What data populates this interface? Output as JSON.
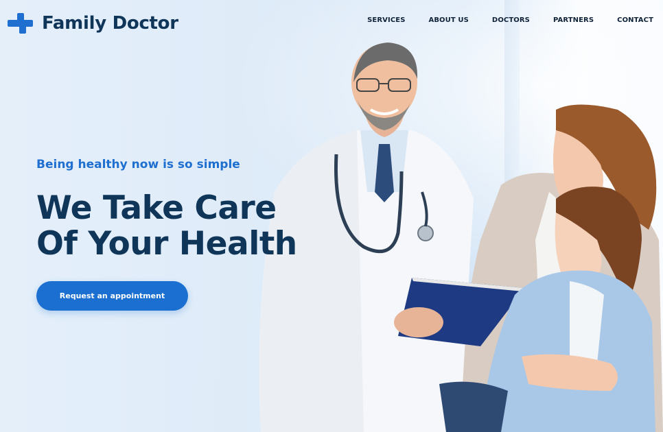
{
  "brand": {
    "name": "Family Doctor",
    "icon": "medical-cross-icon",
    "accent_color": "#1e6fcf",
    "dark_color": "#0f3559"
  },
  "nav": {
    "items": [
      {
        "label": "SERVICES"
      },
      {
        "label": "ABOUT US"
      },
      {
        "label": "DOCTORS"
      },
      {
        "label": "PARTNERS"
      },
      {
        "label": "CONTACT"
      }
    ]
  },
  "hero": {
    "tagline": "Being healthy now is so simple",
    "headline_line1": "We Take Care",
    "headline_line2": "Of Your Health",
    "cta_label": "Request an appointment",
    "image": "doctor-with-mother-and-daughter-photo"
  }
}
